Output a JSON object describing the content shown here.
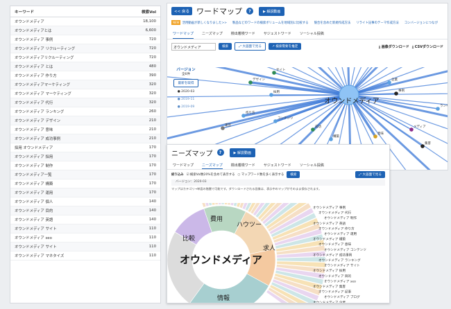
{
  "keywords": {
    "col_keyword": "キーワード",
    "col_volume": "検索Vol",
    "rows": [
      {
        "kw": "オウンドメディア",
        "vol": "18,100"
      },
      {
        "kw": "オウンドメディアとは",
        "vol": "6,600"
      },
      {
        "kw": "オウンドメディア 事例",
        "vol": "720"
      },
      {
        "kw": "オウンドメディア リクルーティング",
        "vol": "720"
      },
      {
        "kw": "オウンドメディアリクルーティング",
        "vol": "720"
      },
      {
        "kw": "オウンドメディア とは",
        "vol": "480"
      },
      {
        "kw": "オウンドメディア 作り方",
        "vol": "390"
      },
      {
        "kw": "オウンドメディアマーケティング",
        "vol": "320"
      },
      {
        "kw": "オウンドメディア マーケティング",
        "vol": "320"
      },
      {
        "kw": "オウンドメディア 代行",
        "vol": "320"
      },
      {
        "kw": "オウンドメディア ランキング",
        "vol": "260"
      },
      {
        "kw": "オウンドメディア デザイン",
        "vol": "210"
      },
      {
        "kw": "オウンドメディア 意味",
        "vol": "210"
      },
      {
        "kw": "オウンドメディア 成功事例",
        "vol": "210"
      },
      {
        "kw": "採用 オウンドメディア",
        "vol": "170"
      },
      {
        "kw": "オウンドメディア 採用",
        "vol": "170"
      },
      {
        "kw": "オウンドメディア 制作",
        "vol": "170"
      },
      {
        "kw": "オウンドメディア一覧",
        "vol": "170"
      },
      {
        "kw": "オウンドメディア 構築",
        "vol": "170"
      },
      {
        "kw": "オウンドメディア 運用",
        "vol": "170"
      },
      {
        "kw": "オウンドメディア 個人",
        "vol": "140"
      },
      {
        "kw": "オウンドメディア 目的",
        "vol": "140"
      },
      {
        "kw": "オウンドメディア 英語",
        "vol": "140"
      },
      {
        "kw": "オウンドメディア サイト",
        "vol": "110"
      },
      {
        "kw": "オウンドメディア seo",
        "vol": "110"
      },
      {
        "kw": "オウンドメディア サイト",
        "vol": "110"
      },
      {
        "kw": "オウンドメディア マネタイズ",
        "vol": "110"
      }
    ]
  },
  "wordmap": {
    "back": "<< 戻る",
    "title": "ワードマップ",
    "help": "?",
    "video": "解説動画",
    "new_badge": "NEW",
    "links": [
      "活用動画が新しくなりました>>",
      "製品などのワードの検索ボリュームを地域別に比較する",
      "競合を含めた新規作成方法",
      "リライト記事のテーマ作成方法",
      "コンバージョンにつなが"
    ],
    "tabs": [
      "ワードマップ",
      "ニーズマップ",
      "検出着検ワード",
      "サジェストワード",
      "ソーシャル投稿"
    ],
    "search_value": "オウンドメディア",
    "search_btn": "検索",
    "expand_btn": "大画面で見る",
    "trend_btn": "検索需要を推定",
    "dl_image": "画像ダウンロード",
    "dl_csv": "CSVダウンロード",
    "version_title": "バージョン",
    "version_count": "全6件",
    "version_compare": "最新を取得",
    "versions": [
      "2020-03",
      "2019-11",
      "2019-09"
    ],
    "center": "オウンドメディア",
    "nodes": [
      "デザイン",
      "サイト",
      "採用",
      "作り方",
      "運営",
      "記事",
      "企業",
      "事例",
      "メディア",
      "コンテンツ",
      "成功",
      "構築",
      "意味",
      "集客",
      "ランキング"
    ]
  },
  "needsmap": {
    "title": "ニーズマップ",
    "help": "?",
    "video": "解説動画",
    "tabs": [
      "ワードマップ",
      "ニーズマップ",
      "検出着検ワード",
      "サジェストワード",
      "ソーシャル投稿"
    ],
    "filter_label": "絞り込み",
    "check1": "検索Vol数20%を含めて表示する",
    "check2": "マップワード数を多く表示する",
    "search_btn": "検索",
    "expand_btn": "大画面で見る",
    "version": "バージョン：2020-03",
    "note": "マップはカテゴリ→単語の階層で可能です。ダウンロードされる画像は、表示中のマップがそのまま保存されます。",
    "center": "オウンドメディア",
    "segments": [
      "費用",
      "ハウツー",
      "比較",
      "求人",
      "情報"
    ],
    "list": [
      "オウンドメディア 事例",
      "オウンドメディア 代行",
      "オウンドメディア 制作",
      "オウンドメディア 英語",
      "オウンドメディア 作り方",
      "オウンドメディア 運用",
      "オウンドメディア 構築",
      "オウンドメディア 意味",
      "オウンドメディア コンテンツ",
      "オウンドメディア 成功事例",
      "オウンドメディア ランキング",
      "オウンドメディア サイト",
      "オウンドメディア 採用",
      "オウンドメディア 目的",
      "オウンドメディア seo",
      "オウンドメディア 集客",
      "オウンドメディア 記事",
      "オウンドメディア ブログ",
      "オウンドメディア 企業"
    ]
  }
}
